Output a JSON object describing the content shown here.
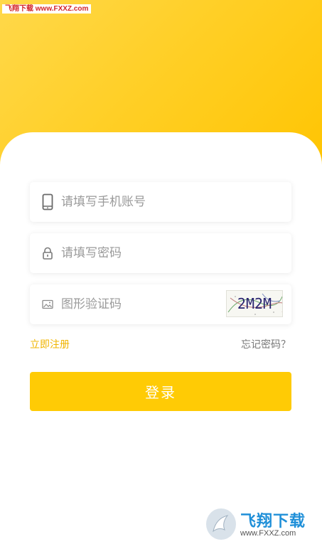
{
  "watermark": {
    "top_text": "飞翔下载 www.FXXZ.com",
    "logo_title": "飞翔下载",
    "logo_url": "www.FXXZ.com"
  },
  "form": {
    "phone": {
      "placeholder": "请填写手机账号",
      "icon": "phone-icon"
    },
    "password": {
      "placeholder": "请填写密码",
      "icon": "lock-icon"
    },
    "captcha": {
      "placeholder": "图形验证码",
      "icon": "image-icon",
      "code": "2M2M"
    }
  },
  "links": {
    "register": "立即注册",
    "forgot": "忘记密码？"
  },
  "login_button": "登录",
  "colors": {
    "accent": "#ffcb05",
    "header_gradient_start": "#ffd84a",
    "header_gradient_end": "#ffc400",
    "register_link": "#f0b400"
  }
}
